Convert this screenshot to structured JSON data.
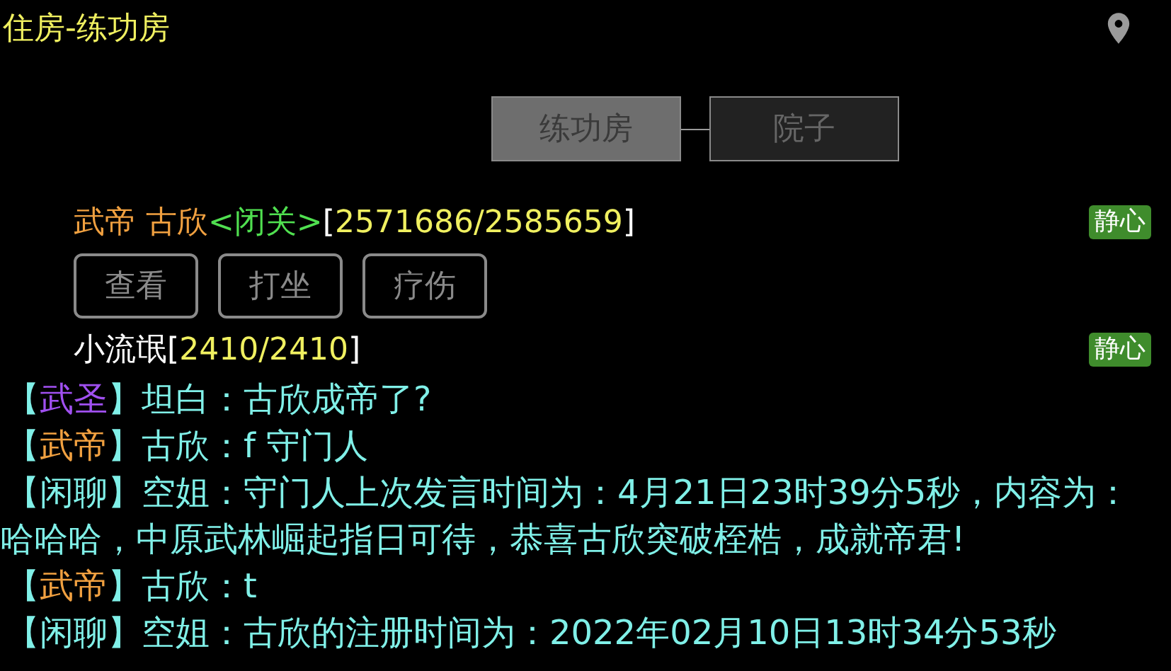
{
  "title": "住房-练功房",
  "rooms": [
    {
      "label": "练功房",
      "selected": true
    },
    {
      "label": "院子",
      "selected": false
    }
  ],
  "players": [
    {
      "segments": [
        {
          "text": "武帝 古欣",
          "color": "#f0a040"
        },
        {
          "text": "<闭关>",
          "color": "#50e050"
        },
        {
          "text": "[",
          "color": "#ffffff"
        },
        {
          "text": "2571686/2585659",
          "color": "#f0f060"
        },
        {
          "text": "]",
          "color": "#ffffff"
        }
      ],
      "badge": "静心",
      "actions": [
        "查看",
        "打坐",
        "疗伤"
      ]
    },
    {
      "segments": [
        {
          "text": "小流氓",
          "color": "#ffffff"
        },
        {
          "text": "[",
          "color": "#ffffff"
        },
        {
          "text": "2410/2410",
          "color": "#f0f060"
        },
        {
          "text": "]",
          "color": "#ffffff"
        }
      ],
      "badge": "静心"
    }
  ],
  "chat": [
    {
      "segments": [
        {
          "text": "【",
          "color": "#80f0e8"
        },
        {
          "text": "武圣",
          "color": "#a050f0"
        },
        {
          "text": "】坦白：古欣成帝了?",
          "color": "#80f0e8"
        }
      ]
    },
    {
      "segments": [
        {
          "text": "【",
          "color": "#80f0e8"
        },
        {
          "text": "武帝",
          "color": "#f0a040"
        },
        {
          "text": "】古欣：f 守门人",
          "color": "#80f0e8"
        }
      ]
    },
    {
      "segments": [
        {
          "text": "【",
          "color": "#80f0e8"
        },
        {
          "text": "闲聊",
          "color": "#80f0e8"
        },
        {
          "text": "】空姐：守门人上次发言时间为：4月21日23时39分5秒，内容为：哈哈哈，中原武林崛起指日可待，恭喜古欣突破桎梏，成就帝君!",
          "color": "#80f0e8"
        }
      ]
    },
    {
      "segments": [
        {
          "text": "【",
          "color": "#80f0e8"
        },
        {
          "text": "武帝",
          "color": "#f0a040"
        },
        {
          "text": "】古欣：t",
          "color": "#80f0e8"
        }
      ]
    },
    {
      "segments": [
        {
          "text": "【",
          "color": "#80f0e8"
        },
        {
          "text": "闲聊",
          "color": "#80f0e8"
        },
        {
          "text": "】空姐：古欣的注册时间为：2022年02月10日13时34分53秒",
          "color": "#80f0e8"
        }
      ]
    }
  ]
}
